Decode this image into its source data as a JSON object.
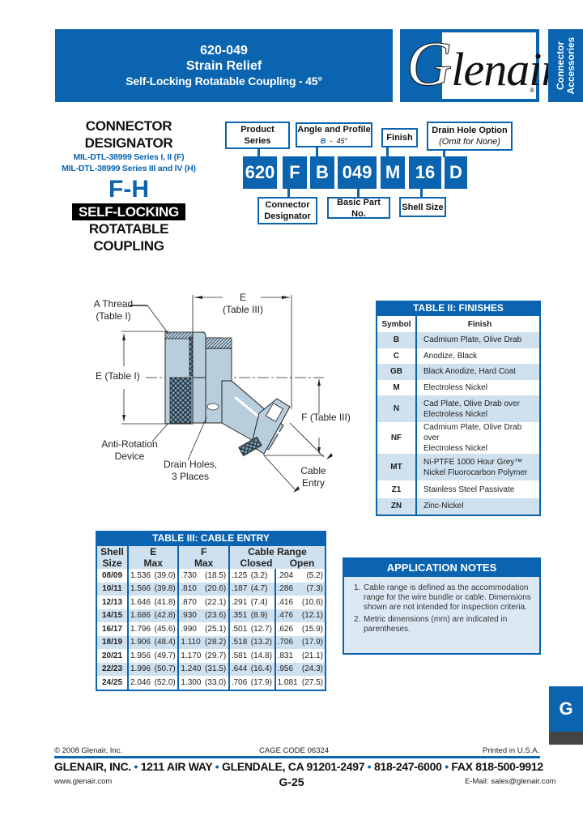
{
  "header": {
    "part_number": "620-049",
    "title": "Strain Relief",
    "subtitle": "Self-Locking Rotatable Coupling - 45°",
    "logo_text": "Glenair",
    "logo_reg": "®",
    "side_tab_line1": "Connector",
    "side_tab_line2": "Accessories"
  },
  "designator": {
    "line1": "CONNECTOR",
    "line2": "DESIGNATOR",
    "mil1": "MIL-DTL-38999 Series I, II (F)",
    "mil2": "MIL-DTL-38999 Series III and IV (H)",
    "code": "F-H",
    "badge": "SELF-LOCKING",
    "line3": "ROTATABLE",
    "line4": "COUPLING"
  },
  "part_builder": {
    "segments": [
      "620",
      "F",
      "B",
      "049",
      "M",
      "16",
      "D"
    ],
    "labels": {
      "product_series": "Product Series",
      "angle_profile": "Angle and Profile",
      "angle_code": "B",
      "angle_sep": "-",
      "angle_value": "45°",
      "finish": "Finish",
      "drain_hole": "Drain Hole Option",
      "drain_hole_note": "(Omit for None)",
      "connector_designator_1": "Connector",
      "connector_designator_2": "Designator",
      "basic_part": "Basic Part No.",
      "shell_size": "Shell Size"
    }
  },
  "diagram": {
    "a_thread_1": "A Thread",
    "a_thread_2": "(Table I)",
    "e_top_1": "E",
    "e_top_2": "(Table III)",
    "e_left": "E (Table I)",
    "f_right": "F (Table III)",
    "anti_rot_1": "Anti-Rotation",
    "anti_rot_2": "Device",
    "drain_1": "Drain Holes,",
    "drain_2": "3 Places",
    "cable_1": "Cable",
    "cable_2": "Entry"
  },
  "table2": {
    "title": "TABLE II: FINISHES",
    "headers": [
      "Symbol",
      "Finish"
    ],
    "rows": [
      {
        "sym": "B",
        "finish": "Cadmium Plate, Olive Drab",
        "finish2": ""
      },
      {
        "sym": "C",
        "finish": "Anodize, Black",
        "finish2": ""
      },
      {
        "sym": "GB",
        "finish": "Black Anodize, Hard Coat",
        "finish2": ""
      },
      {
        "sym": "M",
        "finish": "Electroless Nickel",
        "finish2": ""
      },
      {
        "sym": "N",
        "finish": "Cad Plate, Olive Drab over",
        "finish2": "Electroless Nickel"
      },
      {
        "sym": "NF",
        "finish": "Cadmium Plate, Olive Drab over",
        "finish2": "Electroless Nickel"
      },
      {
        "sym": "MT",
        "finish": "Ni-PTFE 1000 Hour Grey™",
        "finish2": "Nickel Fluorocarbon Polymer"
      },
      {
        "sym": "Z1",
        "finish": "Stainless Steel Passivate",
        "finish2": ""
      },
      {
        "sym": "ZN",
        "finish": "Zinc-Nickel",
        "finish2": ""
      }
    ]
  },
  "table3": {
    "title": "TABLE III: CABLE ENTRY",
    "headers": {
      "shell_1": "Shell",
      "shell_2": "Size",
      "e_1": "E",
      "e_2": "Max",
      "f_1": "F",
      "f_2": "Max",
      "range": "Cable Range",
      "closed": "Closed",
      "open": "Open"
    },
    "rows": [
      {
        "size": "08/09",
        "e": "1.536",
        "e_mm": "(39.0)",
        "f": ".730",
        "f_mm": "(18.5)",
        "closed": ".125",
        "closed_mm": "(3.2)",
        "open": ".204",
        "open_mm": "(5.2)"
      },
      {
        "size": "10/11",
        "e": "1.566",
        "e_mm": "(39.8)",
        "f": ".810",
        "f_mm": "(20.6)",
        "closed": ".187",
        "closed_mm": "(4.7)",
        "open": ".286",
        "open_mm": "(7.3)"
      },
      {
        "size": "12/13",
        "e": "1.646",
        "e_mm": "(41.8)",
        "f": ".870",
        "f_mm": "(22.1)",
        "closed": ".291",
        "closed_mm": "(7.4)",
        "open": ".416",
        "open_mm": "(10.6)"
      },
      {
        "size": "14/15",
        "e": "1.686",
        "e_mm": "(42.8)",
        "f": ".930",
        "f_mm": "(23.6)",
        "closed": ".351",
        "closed_mm": "(8.9)",
        "open": ".476",
        "open_mm": "(12.1)"
      },
      {
        "size": "16/17",
        "e": "1.796",
        "e_mm": "(45.6)",
        "f": ".990",
        "f_mm": "(25.1)",
        "closed": ".501",
        "closed_mm": "(12.7)",
        "open": ".626",
        "open_mm": "(15.9)"
      },
      {
        "size": "18/19",
        "e": "1.906",
        "e_mm": "(48.4)",
        "f": "1.110",
        "f_mm": "(28.2)",
        "closed": ".518",
        "closed_mm": "(13.2)",
        "open": ".706",
        "open_mm": "(17.9)"
      },
      {
        "size": "20/21",
        "e": "1.956",
        "e_mm": "(49.7)",
        "f": "1.170",
        "f_mm": "(29.7)",
        "closed": ".581",
        "closed_mm": "(14.8)",
        "open": ".831",
        "open_mm": "(21.1)"
      },
      {
        "size": "22/23",
        "e": "1.996",
        "e_mm": "(50.7)",
        "f": "1.240",
        "f_mm": "(31.5)",
        "closed": ".644",
        "closed_mm": "(16.4)",
        "open": ".956",
        "open_mm": "(24.3)"
      },
      {
        "size": "24/25",
        "e": "2.046",
        "e_mm": "(52.0)",
        "f": "1.300",
        "f_mm": "(33.0)",
        "closed": ".706",
        "closed_mm": "(17.9)",
        "open": "1.081",
        "open_mm": "(27.5)"
      }
    ]
  },
  "notes": {
    "title": "APPLICATION NOTES",
    "items": [
      {
        "num": "1.",
        "text": "Cable range is defined as the accommodation range for the wire bundle or cable.  Dimensions shown are not intended for inspection criteria."
      },
      {
        "num": "2.",
        "text": "Metric dimensions (mm) are indicated in parentheses."
      }
    ]
  },
  "section_tab": "G",
  "footer": {
    "copyright": "© 2008 Glenair, Inc.",
    "cage": "CAGE CODE 06324",
    "printed": "Printed in U.S.A.",
    "address_parts": [
      "GLENAIR, INC.",
      "1211 AIR WAY",
      "GLENDALE, CA 91201-2497",
      "818-247-6000",
      "FAX 818-500-9912"
    ],
    "separator": "•",
    "website": "www.glenair.com",
    "page": "G-25",
    "email": "E-Mail:  sales@glenair.com"
  },
  "colors": {
    "brand_blue": "#0a64b0",
    "row_alt": "#cfe0ee"
  }
}
